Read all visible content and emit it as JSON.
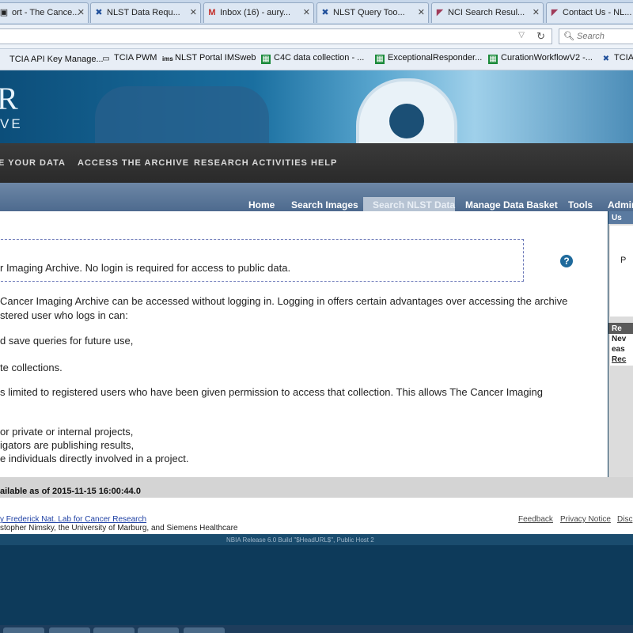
{
  "browser": {
    "tabs": [
      {
        "label": "ort - The Cance...",
        "icon": "page-icon"
      },
      {
        "label": "NLST Data Requ...",
        "icon": "nlst-icon"
      },
      {
        "label": "Inbox (16) - aury...",
        "icon": "gmail-icon"
      },
      {
        "label": "NLST Query Too...",
        "icon": "nlst-tool-icon"
      },
      {
        "label": "NCI Search Resul...",
        "icon": "nci-icon"
      },
      {
        "label": "Contact Us - NL...",
        "icon": "nci-icon"
      }
    ],
    "tab_close": "✕",
    "search_placeholder": "Search",
    "bookmarks": [
      {
        "label": "TCIA API Key Manage...",
        "icon": "page-icon"
      },
      {
        "label": "TCIA PWM",
        "icon": "tcia-icon"
      },
      {
        "label": "NLST Portal IMSweb",
        "icon": "ims-icon"
      },
      {
        "label": "C4C data collection - ...",
        "icon": "sheet-icon"
      },
      {
        "label": "ExceptionalResponder...",
        "icon": "sheet-icon"
      },
      {
        "label": "CurationWorkflowV2 -...",
        "icon": "sheet-icon"
      },
      {
        "label": "TCIA",
        "icon": "tcia-x-icon"
      }
    ]
  },
  "banner": {
    "logo_line1": "R",
    "logo_line2": "VE"
  },
  "mainnav": [
    "E YOUR DATA",
    "ACCESS THE ARCHIVE",
    "RESEARCH ACTIVITIES",
    "HELP"
  ],
  "tabs": [
    "Home",
    "Search Images",
    "Search NLST Data",
    "Manage Data Basket",
    "Tools",
    "Admin"
  ],
  "content": {
    "notice": "r Imaging Archive. No login is required for access to public data.",
    "para1_line1": "Cancer Imaging Archive can be accessed without logging in. Logging in offers certain advantages over accessing the archive",
    "para1_line2": "stered user who logs in can:",
    "item1": "d save queries for future use,",
    "item2": "te collections.",
    "para2": "s limited to registered users who have been given permission to access that collection. This allows The Cancer Imaging",
    "item3": "or private or internal projects,",
    "item4": "igators are publishing results,",
    "item5": "e individuals directly involved in a project.",
    "help_icon": "?"
  },
  "rightcol": {
    "top_label": "Us",
    "mid_label": "P",
    "recent_label": "Re",
    "line1": "Nev",
    "line2": "eas",
    "link": "Rec"
  },
  "available": "ailable as of 2015-11-15 16:00:44.0",
  "footer": {
    "link1": "y Frederick Nat. Lab for Cancer Research",
    "credit": "stopher Nimsky, the University of Marburg, and Siemens Healthcare",
    "feedback": "Feedback",
    "privacy": "Privacy Notice",
    "disclaimer": "Disc"
  },
  "status": "NBIA Release 6.0 Build \"$HeadURL$\", Public Host 2"
}
